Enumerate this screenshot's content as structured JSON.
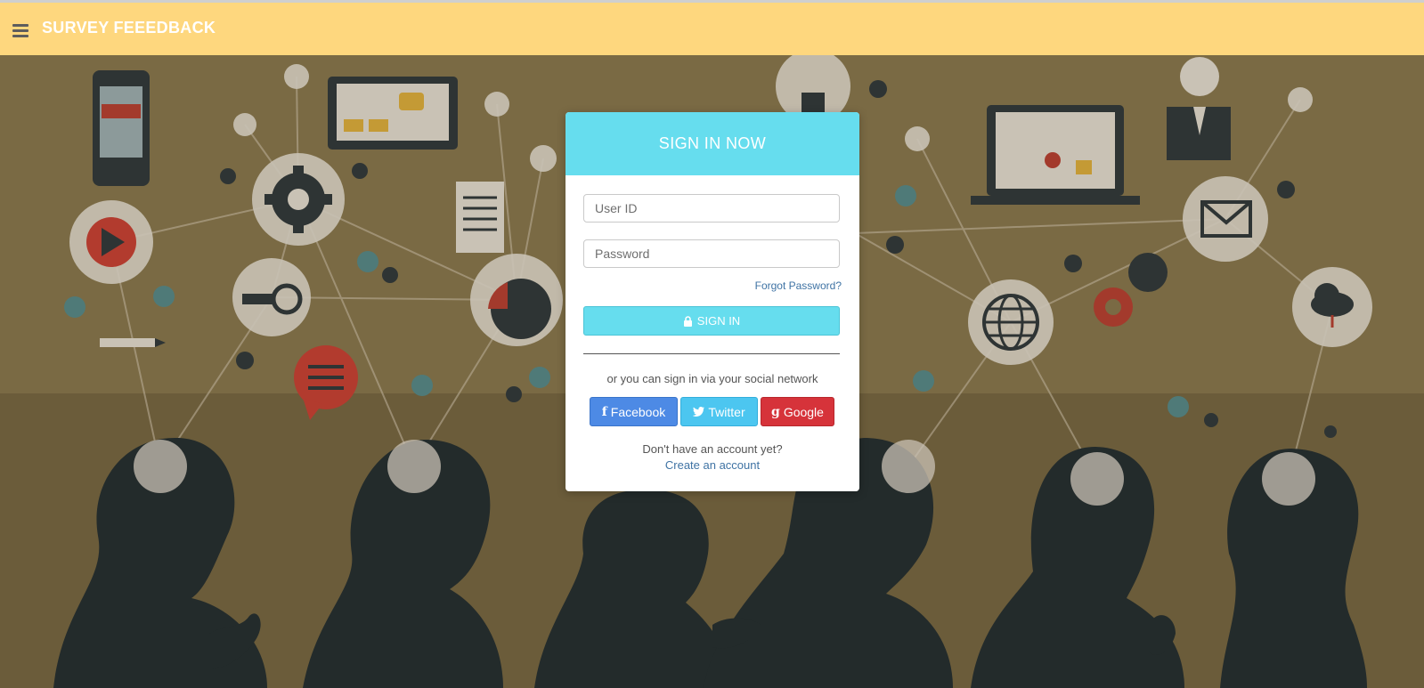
{
  "header": {
    "brand": "SURVEY FEEEDBACK",
    "menu_icon": "hamburger-menu-icon",
    "background_color": "#fed77e"
  },
  "background": {
    "base_color": "#7a6a44",
    "silhouette_color": "#232b2b",
    "icon_color": "#c9c2b5"
  },
  "login": {
    "title": "SIGN IN NOW",
    "accent_color": "#66ddee",
    "user_placeholder": "User ID",
    "password_placeholder": "Password",
    "forgot_label": "Forgot Password?",
    "signin_label": "SIGN IN",
    "signin_icon": "lock-icon",
    "or_text": "or you can sign in via your social network",
    "social": {
      "facebook_label": "Facebook",
      "twitter_label": "Twitter",
      "google_label": "Google",
      "facebook_icon": "facebook-icon",
      "twitter_icon": "twitter-icon",
      "google_icon": "google-icon",
      "facebook_color": "#4d8ae5",
      "twitter_color": "#4cc6f0",
      "google_color": "#d6333a"
    },
    "no_account_text": "Don't have an account yet?",
    "create_account_label": "Create an account"
  }
}
